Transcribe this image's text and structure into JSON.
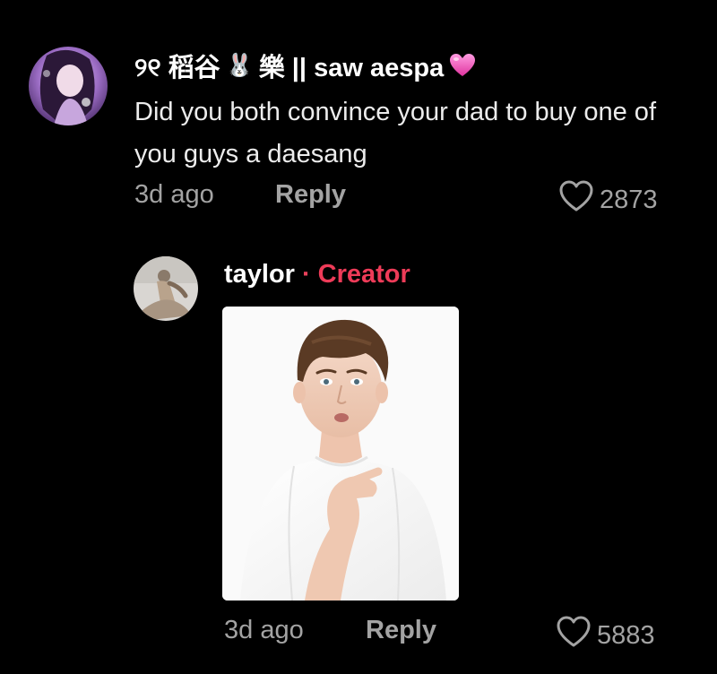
{
  "parent_comment": {
    "username": "୨୧ 稻谷 樂 || saw aespa",
    "username_prefix": "୨୧ 稻谷",
    "username_emoji": "🐰",
    "username_suffix": "樂 || saw aespa",
    "username_heart_color": "#ff6ec7",
    "text": "Did you both convince your dad to buy one of you guys a daesang",
    "time": "3d ago",
    "reply_label": "Reply",
    "likes": "2873"
  },
  "reply_comment": {
    "username": "taylor",
    "separator": "·",
    "badge": "Creator",
    "badge_color": "#ee3b58",
    "time": "3d ago",
    "reply_label": "Reply",
    "likes": "5883"
  },
  "icons": {
    "like": "heart-outline-icon",
    "username_heart": "pink-heart-icon"
  },
  "colors": {
    "background": "#000000",
    "primary_text": "#ffffff",
    "secondary_text": "#a3a3a3"
  }
}
